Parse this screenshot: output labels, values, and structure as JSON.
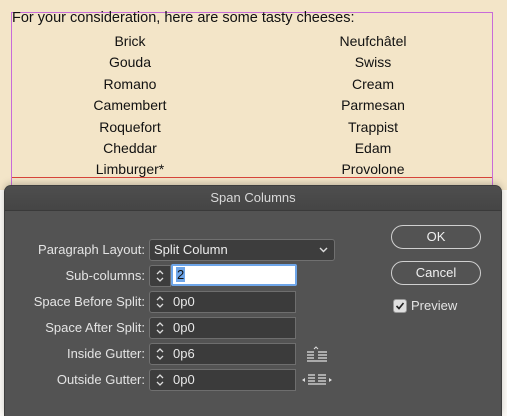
{
  "document": {
    "intro": "For your consideration, here are some tasty cheeses:",
    "left_column": [
      "Brick",
      "Gouda",
      "Romano",
      "Camembert",
      "Roquefort",
      "Cheddar",
      "Limburger*"
    ],
    "right_column": [
      "Neufchâtel",
      "Swiss",
      "Cream",
      "Parmesan",
      "Trappist",
      "Edam",
      "Provolone"
    ]
  },
  "dialog": {
    "title": "Span Columns",
    "paragraph_layout": {
      "label": "Paragraph Layout:",
      "value": "Split Column"
    },
    "sub_columns": {
      "label": "Sub-columns:",
      "value": "2"
    },
    "space_before_split": {
      "label": "Space Before Split:",
      "value": "0p0"
    },
    "space_after_split": {
      "label": "Space After Split:",
      "value": "0p0"
    },
    "inside_gutter": {
      "label": "Inside Gutter:",
      "value": "0p6"
    },
    "outside_gutter": {
      "label": "Outside Gutter:",
      "value": "0p0"
    },
    "ok_label": "OK",
    "cancel_label": "Cancel",
    "preview": {
      "label": "Preview",
      "checked": true
    }
  },
  "icons": [
    "chevron-down-icon",
    "stepper-arrows-icon",
    "inside-gutter-icon",
    "outside-gutter-icon",
    "checkmark-icon"
  ],
  "colors": {
    "document_bg": "#f3e5c8",
    "frame": "#c86bd9",
    "dialog_bg": "#535353",
    "focus": "#6ea5e8"
  }
}
